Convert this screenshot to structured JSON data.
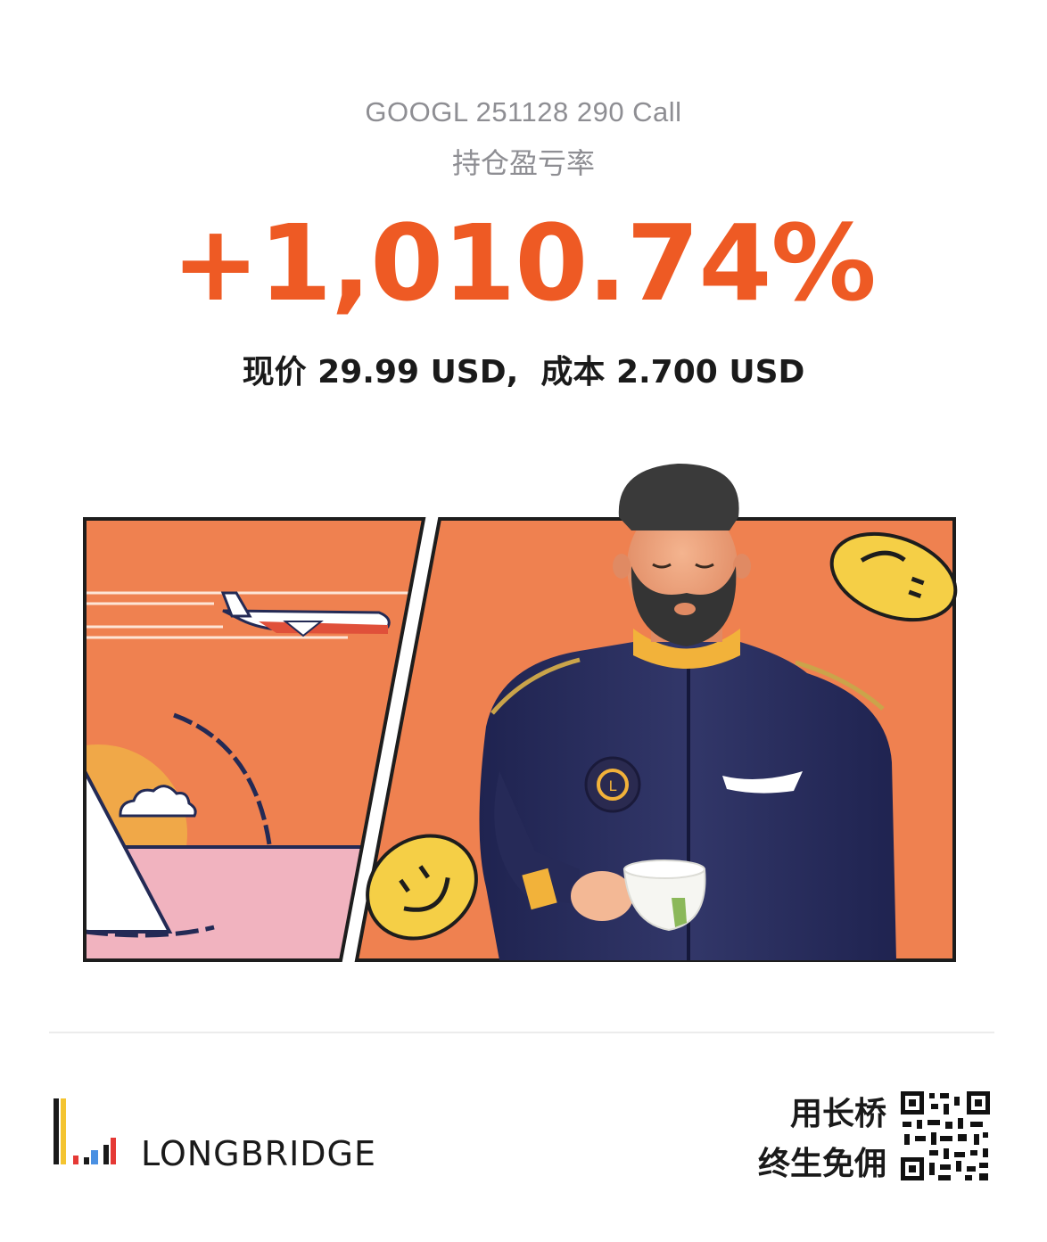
{
  "card": {
    "ticker": "GOOGL 251128 290 Call",
    "metric_label": "持仓盈亏率",
    "pl_rate": "+1,010.74%",
    "price_label": "现价",
    "price_value": "29.99 USD,",
    "cost_label": "成本",
    "cost_value": "2.700 USD"
  },
  "footer": {
    "brand": "LONGBRIDGE",
    "promo_line1": "用长桥",
    "promo_line2": "终生免佣"
  },
  "colors": {
    "accent": "#ee5a24",
    "panel_orange": "#ef8150",
    "uniform": "#2b2f5e",
    "coin": "#f5cf46"
  },
  "icons": [
    "airplane-icon",
    "cloud-icon",
    "smiley-coin-icon",
    "qr-code-icon",
    "longbridge-logo-icon"
  ]
}
